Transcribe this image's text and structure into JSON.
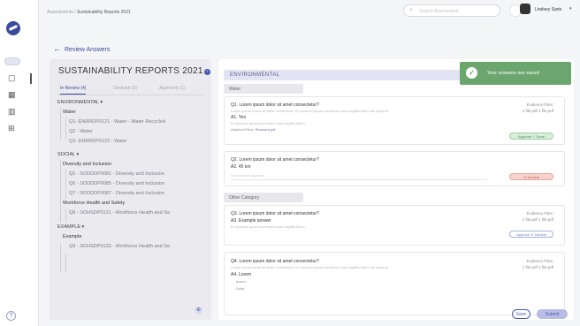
{
  "breadcrumb": {
    "parent": "Assessments",
    "sep": "/",
    "current": "Sustainability Reports 2021"
  },
  "search": {
    "placeholder": "Search Assessment"
  },
  "user": {
    "name": "Lindsey Sarts"
  },
  "back": {
    "label": "Review Answers"
  },
  "left_panel": {
    "title": "SUSTAINABILITY REPORTS 2021",
    "tabs": [
      {
        "label": "In Review (4)"
      },
      {
        "label": "Declined (3)"
      },
      {
        "label": "Approved (1)"
      }
    ],
    "tree": [
      {
        "kind": "section",
        "label": "ENVIRONMENTAL ▾"
      },
      {
        "kind": "group",
        "label": "Water"
      },
      {
        "kind": "q",
        "label": "Q1- ENRRDP0121 - Water - Water Recycled"
      },
      {
        "kind": "q",
        "label": "Q2 - Water"
      },
      {
        "kind": "q",
        "label": "Q3- ENRRDP0122 - Water"
      },
      {
        "kind": "section",
        "label": "SOCIAL ▾"
      },
      {
        "kind": "group",
        "label": "Diversity and Inclusion"
      },
      {
        "kind": "q",
        "label": "Q5 - SODDDP0081 - Diversity and Inclusion"
      },
      {
        "kind": "q",
        "label": "Q6 - SODDDP0085 - Diversity and Inclusion"
      },
      {
        "kind": "q",
        "label": "Q7 - SODDDP0087 - Diversity and Inclusion"
      },
      {
        "kind": "group",
        "label": "Workforce Health and Safety"
      },
      {
        "kind": "q",
        "label": "Q8 - SOHSDP0121 - Workforce Health and Sa"
      },
      {
        "kind": "section",
        "label": "EXAMPLE ▾"
      },
      {
        "kind": "group",
        "label": "Example"
      },
      {
        "kind": "q",
        "label": "Q9 - SOHSDP0120 - Workforce Health and Sa"
      }
    ]
  },
  "main": {
    "section_title": "ENVIRONMENTAL",
    "category_water": "Water",
    "category_other": "Other Category",
    "questions": [
      {
        "q": "Q1. Lorem ipsum dolor sit amet consectetur?",
        "desc1": "Lorem ipsum lorem sit amet consectetur. Ex possum quam commodo cons sagittis libero lac pulvinar.",
        "a": "A1. Yes",
        "desc2": "Ex possum quam commodo cons sagittis libero.",
        "attached": "Attached Files:",
        "attached_file": "Sharcard.pdf",
        "evidence_title": "Evidence Files:",
        "evidence_files": "1 file.pdf  1 file.pdf",
        "status": "Approve ✓ Done"
      },
      {
        "q": "Q2. Lorem ipsum dolor sit amet consectetur?",
        "a": "A2. 45 km",
        "comment_placeholder": "Comment to approve",
        "status": "✕ Decline"
      },
      {
        "q": "Q3. Lorem ipsum dolor sit amet consectetur?",
        "a": "A3. Example answer",
        "desc2": "Ex possum quam commodo cons sagittis libero.",
        "evidence_title": "Evidence Files:",
        "evidence_files": "1 file.pdf  1 file.pdf",
        "status": "Approve  ✕ Decline"
      },
      {
        "q": "Q4. Lorem ipsum dolor sit amet consectetur?",
        "desc1": "Lorem ipsum lorem sit amet consectetur. Ex possum quam commodo cons sagittis libero lac pulvinar.",
        "a": "A4. Lorem",
        "a_extra1": "Ipsum",
        "a_extra2": "Dolor",
        "evidence_title": "Evidence Files:",
        "evidence_files": "1 file.pdf  1 file.pdf"
      }
    ]
  },
  "toast": {
    "text": "Your answers are saved"
  },
  "actions": {
    "save": "Save",
    "submit": "Submit"
  },
  "colors": {
    "accent": "#4a5bb0",
    "success": "#6aa66e",
    "decline": "#c35649",
    "section_bg": "#e2e3f3"
  }
}
